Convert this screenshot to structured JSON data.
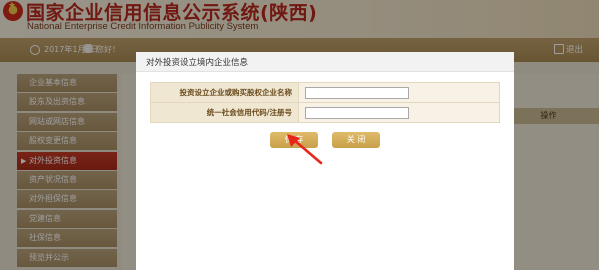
{
  "header": {
    "title": "国家企业信用信息公示系统(陕西)",
    "subtitle": "National Enterprise Credit Information Publicity System"
  },
  "infobar": {
    "date": "2017年1月6日",
    "user": "您好！",
    "exit": "退出"
  },
  "sidebar": {
    "items": [
      {
        "label": "企业基本信息"
      },
      {
        "label": "股东及出资信息"
      },
      {
        "label": "网站或网店信息"
      },
      {
        "label": "股权变更信息"
      },
      {
        "label": "对外投资信息",
        "active": true
      },
      {
        "label": "资产状况信息"
      },
      {
        "label": "对外担保信息"
      },
      {
        "label": "党建信息"
      },
      {
        "label": "社保信息"
      },
      {
        "label": "预览并公示"
      }
    ]
  },
  "table_header": {
    "action": "操作"
  },
  "modal": {
    "title": "对外投资设立境内企业信息",
    "fields": [
      {
        "label": "投资设立企业或购买股权企业名称",
        "value": "",
        "placeholder": ""
      },
      {
        "label": "统一社会信用代码/注册号",
        "value": "",
        "placeholder": ""
      }
    ],
    "save_label": "保 存",
    "close_label": "关 闭"
  },
  "colors": {
    "title_red": "#b5281c",
    "button_gold": "#d1aa55",
    "sidebar_active": "#b23220",
    "arrow_red": "#e8271c"
  }
}
